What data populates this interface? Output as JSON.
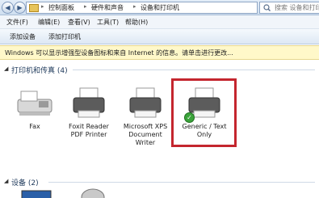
{
  "address_bar": {
    "crumbs": [
      "控制面板",
      "硬件和声音",
      "设备和打印机"
    ],
    "search_placeholder": "搜索 设备和打印机"
  },
  "menu": [
    "文件(F)",
    "编辑(E)",
    "查看(V)",
    "工具(T)",
    "帮助(H)"
  ],
  "commands": [
    "添加设备",
    "添加打印机"
  ],
  "info_bar": "Windows 可以显示增强型设备图标和来自 Internet 的信息。请单击进行更改...",
  "groups": {
    "printers_title": "打印机和传真 (4)",
    "devices_title": "设备 (2)"
  },
  "printers": [
    {
      "label": "Fax"
    },
    {
      "label": "Foxit Reader\nPDF Printer"
    },
    {
      "label": "Microsoft XPS\nDocument\nWriter"
    },
    {
      "label": "Generic / Text\nOnly"
    }
  ],
  "colors": {
    "highlight": "#c4262e",
    "default_check": "#3aa33a"
  }
}
